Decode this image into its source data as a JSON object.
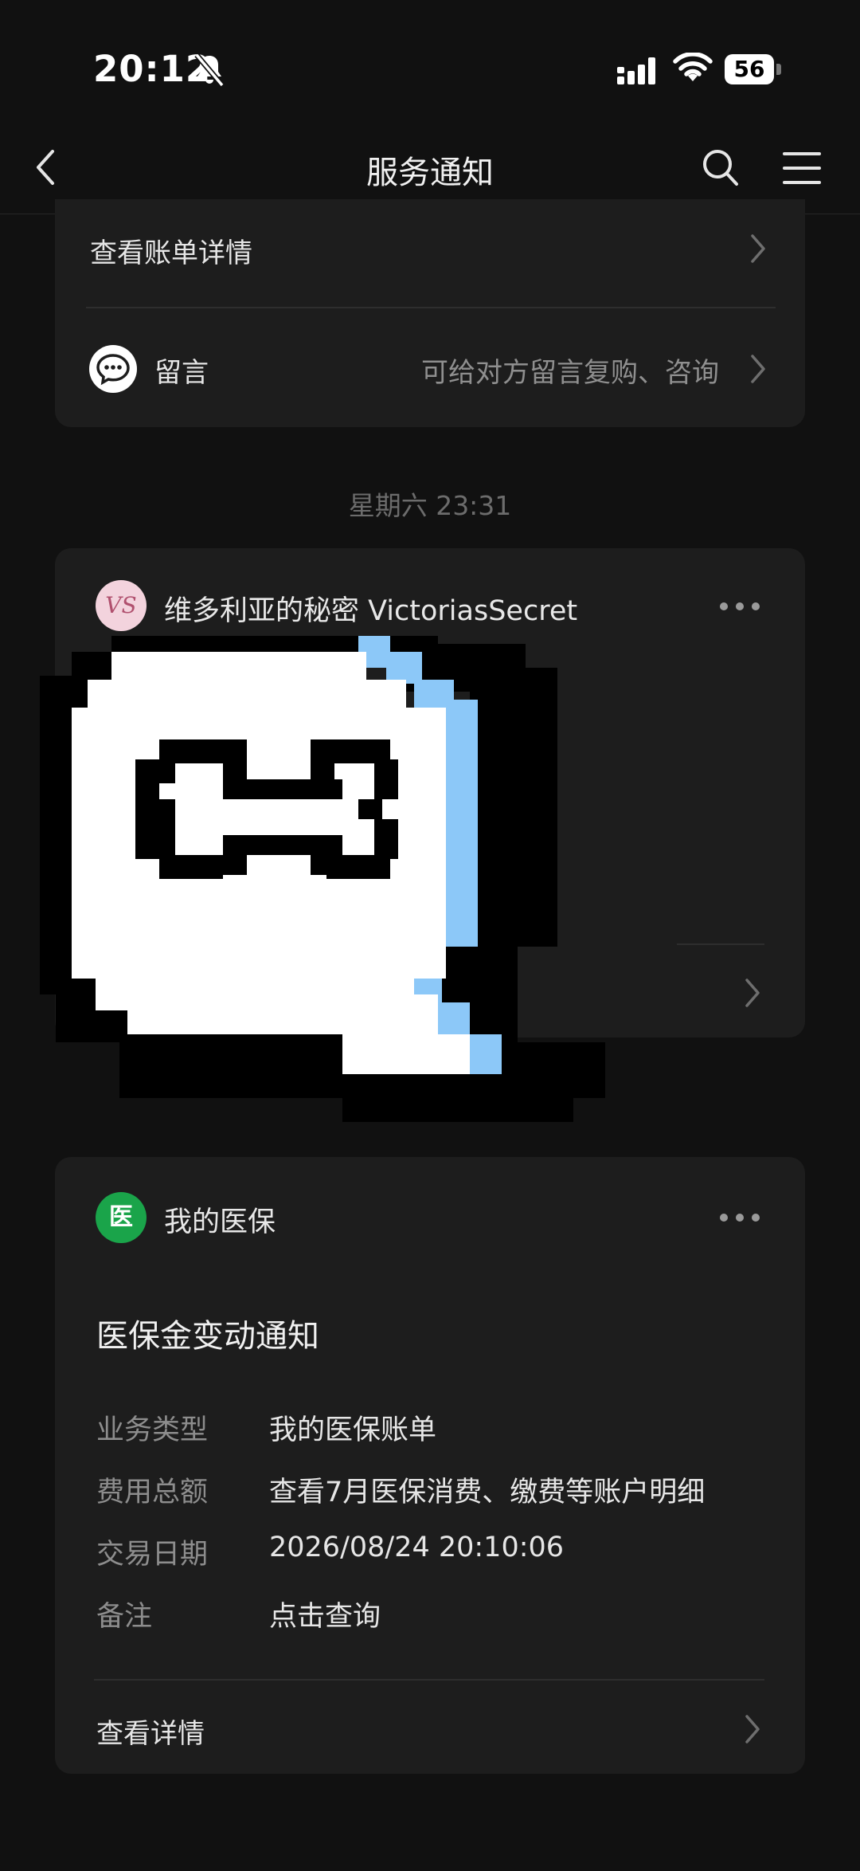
{
  "status_bar": {
    "time": "20:12",
    "battery": "56",
    "icons": [
      "bell-slash-icon",
      "cellular-signal-icon",
      "wifi-icon",
      "battery-icon"
    ]
  },
  "nav": {
    "title": "服务通知",
    "icons": [
      "back-chevron-icon",
      "search-icon",
      "menu-icon"
    ]
  },
  "card_top": {
    "view_bill_label": "查看账单详情",
    "message_label": "留言",
    "message_hint": "可给对方留言复购、咨询"
  },
  "timestamp": "星期六 23:31",
  "card_vs": {
    "avatar_text": "VS",
    "sender": "维多利亚的秘密 VictoriasSecret",
    "sticker_icon": "pixel-speech-bubble-bone-sticker"
  },
  "card_yibao": {
    "avatar_text": "医",
    "sender": "我的医保",
    "notice_title": "医保金变动通知",
    "rows": [
      {
        "label": "业务类型",
        "value": "我的医保账单"
      },
      {
        "label": "费用总额",
        "value": "查看7月医保消费、缴费等账户明细"
      },
      {
        "label": "交易日期",
        "value": "2026/08/24 20:10:06"
      },
      {
        "label": "备注",
        "value": "点击查询"
      }
    ],
    "details_label": "查看详情"
  },
  "colors": {
    "background": "#111111",
    "card": "#1d1d1d",
    "yibao_green": "#1aa44a",
    "vs_pink": "#f3d3dd",
    "sticker_blue": "#8cc8f8"
  }
}
